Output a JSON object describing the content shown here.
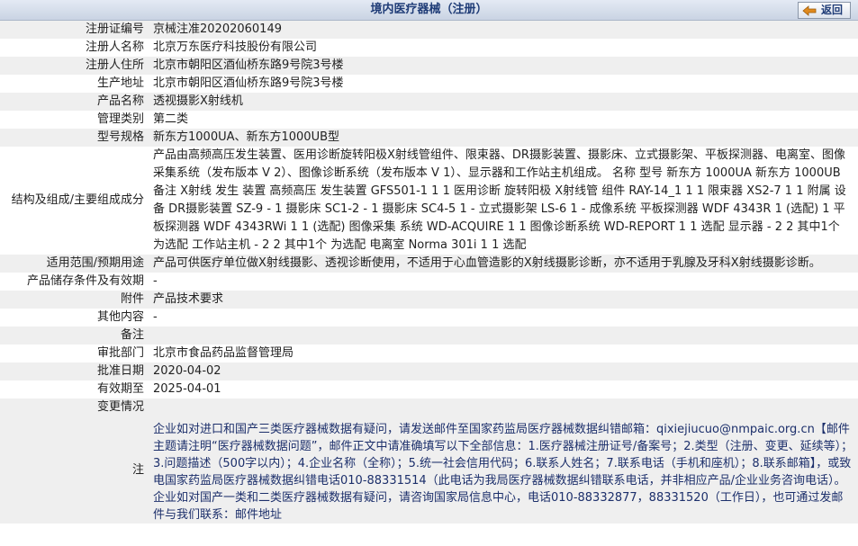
{
  "header": {
    "title": "境内医疗器械（注册）",
    "back_label": "返回"
  },
  "rows": [
    {
      "label": "注册证编号",
      "value": "京械注准20202060149"
    },
    {
      "label": "注册人名称",
      "value": "北京万东医疗科技股份有限公司"
    },
    {
      "label": "注册人住所",
      "value": "北京市朝阳区酒仙桥东路9号院3号楼"
    },
    {
      "label": "生产地址",
      "value": "北京市朝阳区酒仙桥东路9号院3号楼"
    },
    {
      "label": "产品名称",
      "value": "透视摄影X射线机"
    },
    {
      "label": "管理类别",
      "value": "第二类"
    },
    {
      "label": "型号规格",
      "value": "新东方1000UA、新东方1000UB型"
    },
    {
      "label": "结构及组成/主要组成成分",
      "value": "产品由高频高压发生装置、医用诊断旋转阳极X射线管组件、限束器、DR摄影装置、摄影床、立式摄影架、平板探测器、电离室、图像采集系统（发布版本 V 2）、图像诊断系统（发布版本 V 1）、显示器和工作站主机组成。 名称 型号 新东方 1000UA 新东方 1000UB 备注 X射线 发生 装置 高频高压 发生装置 GFS501-1 1 1 医用诊断 旋转阳极 X射线管 组件 RAY-14_1 1 1 限束器 XS2-7 1 1 附属 设备 DR摄影装置 SZ-9 - 1 摄影床 SC1-2 - 1 摄影床 SC4-5 1 - 立式摄影架 LS-6 1 - 成像系统 平板探测器 WDF 4343R 1 (选配) 1 平板探测器 WDF 4343RWi 1 1 (选配) 图像采集 系统 WD-ACQUIRE 1 1 图像诊断系统 WD-REPORT 1 1 选配 显示器 - 2 2 其中1个 为选配 工作站主机 - 2 2 其中1个 为选配 电离室 Norma 301i 1 1 选配"
    },
    {
      "label": "适用范围/预期用途",
      "value": "产品可供医疗单位做X射线摄影、透视诊断使用，不适用于心血管造影的X射线摄影诊断，亦不适用于乳腺及牙科X射线摄影诊断。"
    },
    {
      "label": "产品储存条件及有效期",
      "value": "-"
    },
    {
      "label": "附件",
      "value": "产品技术要求"
    },
    {
      "label": "其他内容",
      "value": "-"
    },
    {
      "label": "备注",
      "value": ""
    },
    {
      "label": "审批部门",
      "value": "北京市食品药品监督管理局"
    },
    {
      "label": "批准日期",
      "value": "2020-04-02"
    },
    {
      "label": "有效期至",
      "value": "2025-04-01"
    },
    {
      "label": "变更情况",
      "value": ""
    }
  ],
  "notice": {
    "label": "注",
    "text": "企业如对进口和国产三类医疗器械数据有疑问，请发送邮件至国家药监局医疗器械数据纠错邮箱：qixiejiucuo@nmpaic.org.cn【邮件主题请注明“医疗器械数据问题”，邮件正文中请准确填写以下全部信息：1.医疗器械注册证号/备案号；2.类型（注册、变更、延续等）；3.问题描述（500字以内）；4.企业名称（全称）；5.统一社会信用代码；6.联系人姓名；7.联系电话（手机和座机）；8.联系邮箱】，或致电国家药监局医疗器械数据纠错电话010-88331514（此电话为我局医疗器械数据纠错联系电话，并非相应产品/企业业务咨询电话）。企业如对国产一类和二类医疗器械数据有疑问，请咨询国家局信息中心，电话010-88332877，88331520（工作日），也可通过发邮件与我们联系：邮件地址"
  }
}
